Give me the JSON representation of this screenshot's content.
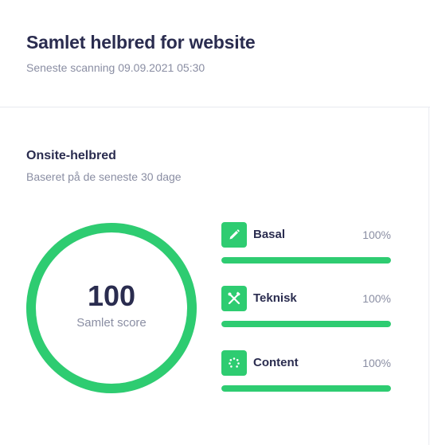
{
  "header": {
    "title": "Samlet helbred for website",
    "subtitle": "Seneste scanning 09.09.2021 05:30"
  },
  "onsite": {
    "title": "Onsite-helbred",
    "subtitle": "Baseret på de seneste 30 dage",
    "score": {
      "value": "100",
      "label": "Samlet score",
      "fraction": 1.0
    },
    "metrics": [
      {
        "name": "Basal",
        "percent_text": "100%",
        "value": 100,
        "icon": "pencil-icon"
      },
      {
        "name": "Teknisk",
        "percent_text": "100%",
        "value": 100,
        "icon": "tools-icon"
      },
      {
        "name": "Content",
        "percent_text": "100%",
        "value": 100,
        "icon": "content-spinner-icon"
      }
    ]
  },
  "colors": {
    "accent": "#2ecc71",
    "title": "#2a2c4f",
    "muted": "#8a8ea3"
  }
}
